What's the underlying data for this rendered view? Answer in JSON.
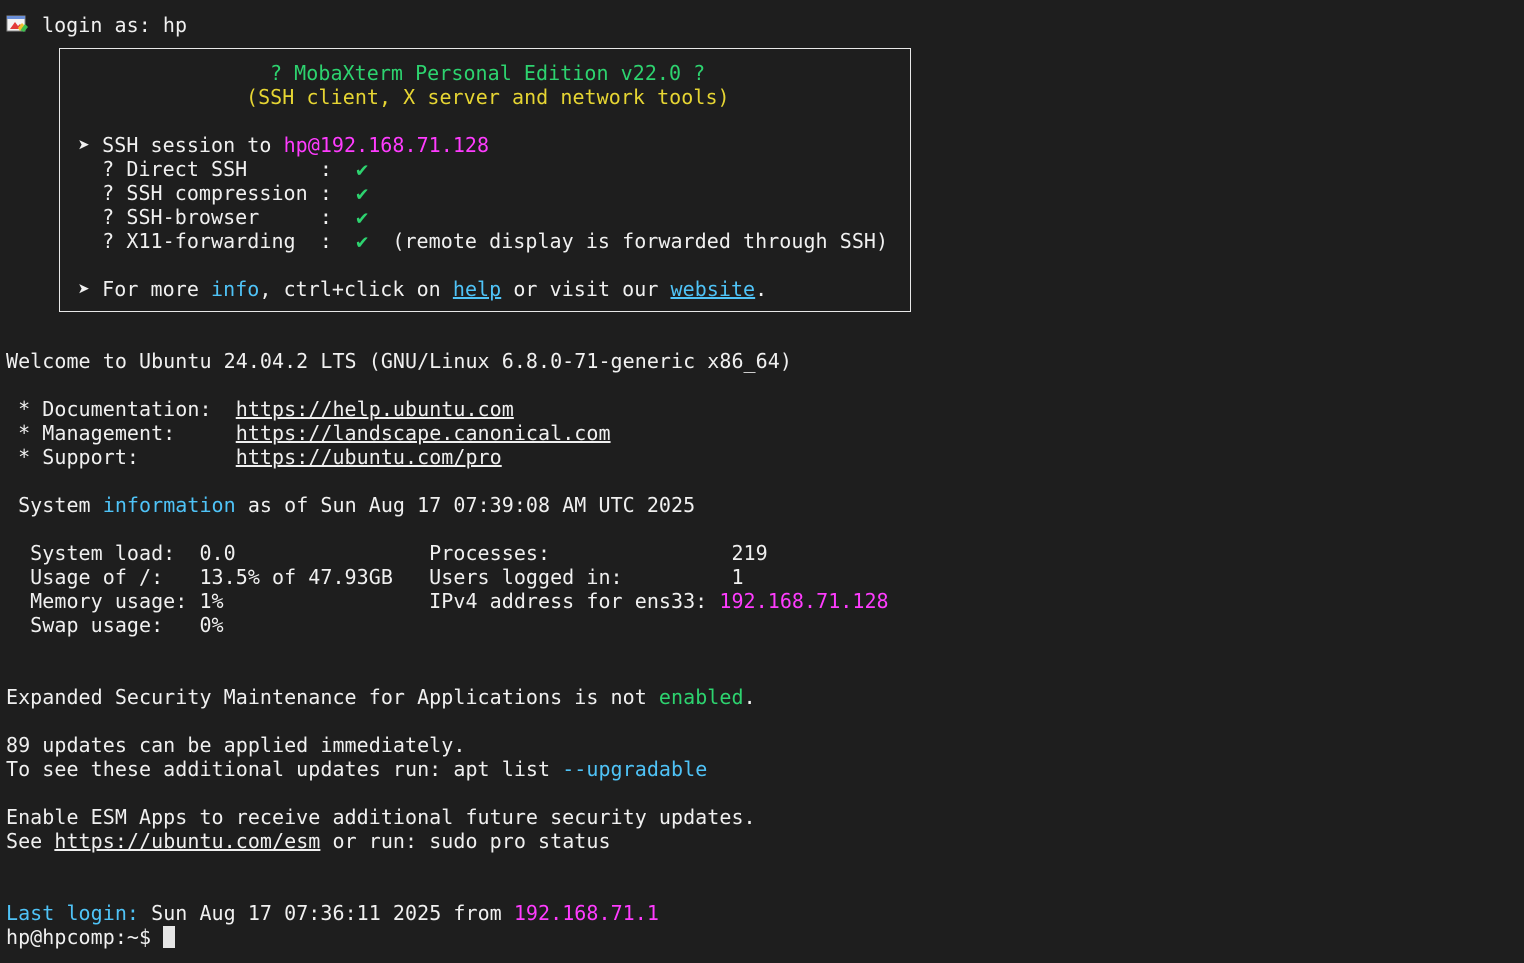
{
  "login": {
    "prompt": "login as: ",
    "user": "hp"
  },
  "banner": {
    "title": "? MobaXterm Personal Edition v22.0 ?",
    "subtitle": "(SSH client, X server and network tools)",
    "session_prefix": "➤ SSH session to ",
    "session_target": "hp@192.168.71.128",
    "features": [
      {
        "label": "  ? Direct SSH      :  ",
        "check": "✔",
        "note": ""
      },
      {
        "label": "  ? SSH compression :  ",
        "check": "✔",
        "note": ""
      },
      {
        "label": "  ? SSH-browser     :  ",
        "check": "✔",
        "note": ""
      },
      {
        "label": "  ? X11-forwarding  :  ",
        "check": "✔",
        "note": "  (remote display is forwarded through SSH)"
      }
    ],
    "more_prefix": "➤ For more ",
    "more_info": "info",
    "more_mid": ", ctrl+click on ",
    "more_help": "help",
    "more_mid2": " or visit our ",
    "more_website": "website",
    "more_end": "."
  },
  "welcome": "Welcome to Ubuntu 24.04.2 LTS (GNU/Linux 6.8.0-71-generic x86_64)",
  "links": [
    {
      "label": " * Documentation:  ",
      "url": "https://help.ubuntu.com"
    },
    {
      "label": " * Management:     ",
      "url": "https://landscape.canonical.com"
    },
    {
      "label": " * Support:        ",
      "url": "https://ubuntu.com/pro"
    }
  ],
  "sysinfo": {
    "prefix": " System ",
    "word": "information",
    "suffix": " as of Sun Aug 17 07:39:08 AM UTC 2025",
    "rows": [
      {
        "left": "  System load:  0.0                Processes:               ",
        "right": "219",
        "right_color": "white"
      },
      {
        "left": "  Usage of /:   13.5% of 47.93GB   Users logged in:         ",
        "right": "1",
        "right_color": "white"
      },
      {
        "left": "  Memory usage: 1%                 IPv4 address for ens33: ",
        "right": "192.168.71.128",
        "right_color": "magenta"
      },
      {
        "left": "  Swap usage:   0%",
        "right": "",
        "right_color": "white"
      }
    ]
  },
  "esm": {
    "prefix": "Expanded Security Maintenance for Applications is not ",
    "word": "enabled",
    "suffix": "."
  },
  "updates": {
    "line1": "89 updates can be applied immediately.",
    "line2_prefix": "To see these additional updates run: apt list ",
    "line2_flag": "--upgradable"
  },
  "esm_apps": {
    "line1": "Enable ESM Apps to receive additional future security updates.",
    "line2_prefix": "See ",
    "line2_url": "https://ubuntu.com/esm",
    "line2_suffix": " or run: sudo pro status"
  },
  "last_login": {
    "label": "Last login:",
    "text": " Sun Aug 17 07:36:11 2025 from ",
    "ip": "192.168.71.1"
  },
  "prompt": "hp@hpcomp:~$ ",
  "colors": {
    "background": "#1e1e1e",
    "text": "#f0f0f0",
    "green": "#2dd36f",
    "yellow": "#e6d533",
    "magenta": "#ff3cff",
    "cyan": "#4fc3f7"
  }
}
